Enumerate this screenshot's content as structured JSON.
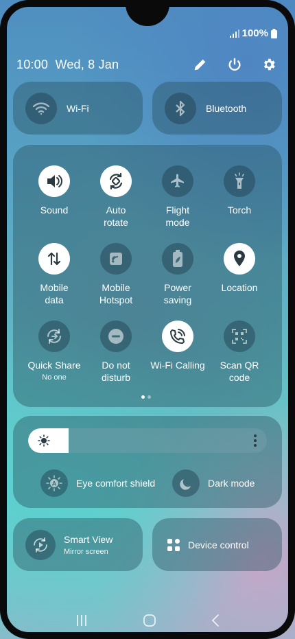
{
  "status": {
    "battery": "100%"
  },
  "header": {
    "time": "10:00",
    "date": "Wed, 8 Jan"
  },
  "connectivity": {
    "wifi_label": "Wi-Fi",
    "bluetooth_label": "Bluetooth"
  },
  "tiles": [
    {
      "label": "Sound",
      "on": true,
      "icon": "sound-icon"
    },
    {
      "label": "Auto\nrotate",
      "on": true,
      "icon": "auto-rotate-icon"
    },
    {
      "label": "Flight\nmode",
      "on": false,
      "icon": "airplane-icon"
    },
    {
      "label": "Torch",
      "on": false,
      "icon": "torch-icon"
    },
    {
      "label": "Mobile\ndata",
      "on": true,
      "icon": "mobile-data-icon"
    },
    {
      "label": "Mobile\nHotspot",
      "on": false,
      "icon": "hotspot-icon"
    },
    {
      "label": "Power\nsaving",
      "on": false,
      "icon": "battery-leaf-icon"
    },
    {
      "label": "Location",
      "on": true,
      "icon": "location-pin-icon"
    },
    {
      "label": "Quick Share",
      "sub": "No one",
      "on": false,
      "icon": "quick-share-icon"
    },
    {
      "label": "Do not\ndisturb",
      "on": false,
      "icon": "do-not-disturb-icon"
    },
    {
      "label": "Wi-Fi Calling",
      "on": true,
      "icon": "wifi-calling-icon"
    },
    {
      "label": "Scan QR\ncode",
      "on": false,
      "icon": "qr-scan-icon"
    }
  ],
  "brightness": {
    "level": 0.17
  },
  "modes": {
    "eye_comfort": "Eye comfort shield",
    "dark_mode": "Dark mode"
  },
  "smart_view": {
    "title": "Smart View",
    "subtitle": "Mirror screen"
  },
  "device_control": {
    "label": "Device control"
  }
}
